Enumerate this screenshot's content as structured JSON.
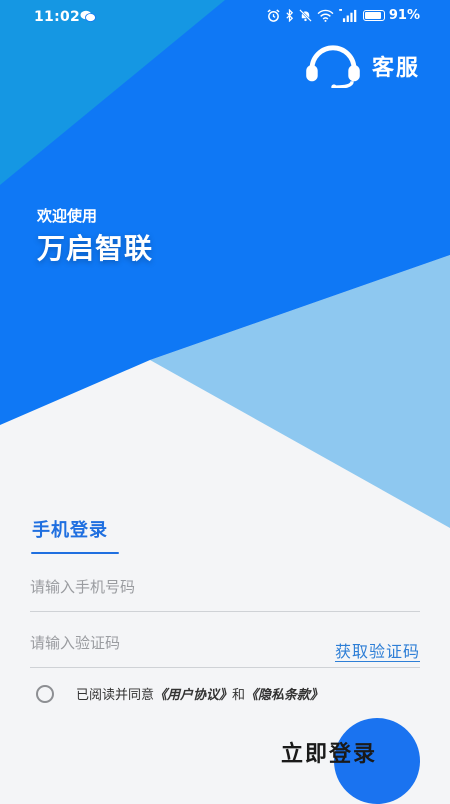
{
  "status_bar": {
    "time": "11:02",
    "battery_percent": "91%",
    "battery_level": 0.91,
    "icons": [
      "wechat-icon",
      "alarm-icon",
      "bluetooth-icon",
      "mute-bell-icon",
      "wifi-icon",
      "signal-icon",
      "battery-icon"
    ]
  },
  "header": {
    "service_label": "客服",
    "service_icon": "headset-icon"
  },
  "welcome": {
    "subtitle": "欢迎使用",
    "app_name": "万启智联"
  },
  "login_tab": {
    "label": "手机登录"
  },
  "phone_field": {
    "placeholder": "请输入手机号码",
    "value": ""
  },
  "code_field": {
    "placeholder": "请输入验证码",
    "value": ""
  },
  "get_code_label": "获取验证码",
  "agreement": {
    "prefix": "已阅读并同意",
    "user_agreement": "《用户协议》",
    "conjunction": "和",
    "privacy_policy": "《隐私条款》"
  },
  "login_button": {
    "label": "立即登录"
  },
  "colors": {
    "primary": "#1a73f0",
    "accent_link": "#2d7ed6",
    "light_blue": "#8ec8f0",
    "sky_blue": "#1597e3",
    "background": "#f4f5f7"
  }
}
